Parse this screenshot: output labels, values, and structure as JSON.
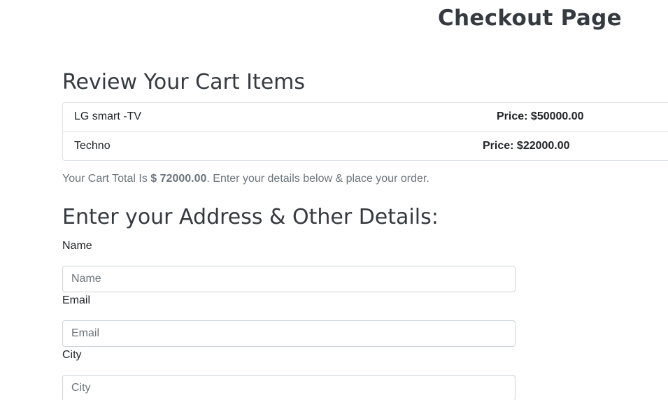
{
  "header": {
    "title": "Checkout Page"
  },
  "cart": {
    "heading": "Review Your Cart Items",
    "items": [
      {
        "name": "LG smart -TV",
        "price": "Price: $50000.00"
      },
      {
        "name": "Techno",
        "price": "Price: $22000.00"
      }
    ],
    "total_prefix": "Your Cart Total Is ",
    "total_value": "$ 72000.00",
    "total_suffix": ". Enter your details below & place your order."
  },
  "details": {
    "heading": "Enter your Address & Other Details:",
    "fields": [
      {
        "label": "Name",
        "placeholder": "Name",
        "value": ""
      },
      {
        "label": "Email",
        "placeholder": "Email",
        "value": ""
      },
      {
        "label": "City",
        "placeholder": "City",
        "value": ""
      }
    ]
  }
}
